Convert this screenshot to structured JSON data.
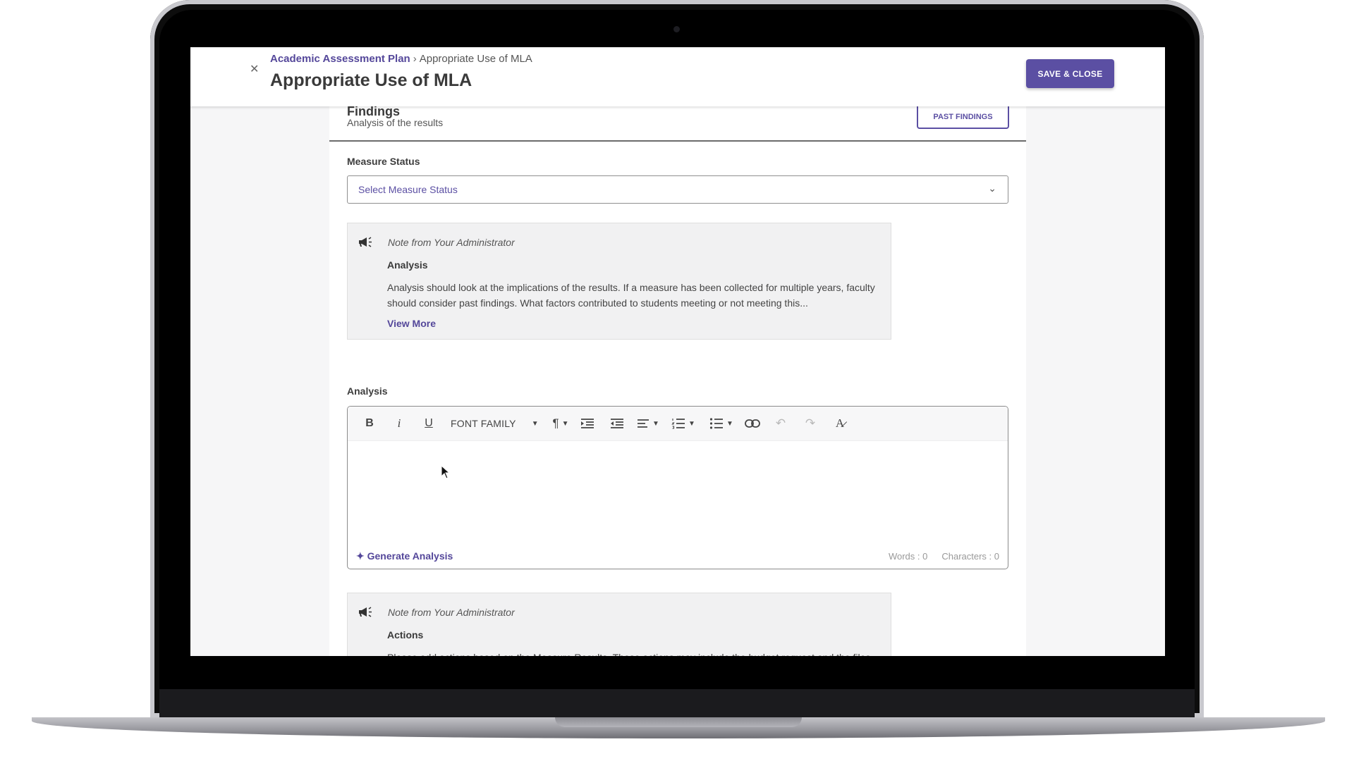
{
  "header": {
    "breadcrumb_parent": "Academic Assessment Plan",
    "breadcrumb_separator": "›",
    "breadcrumb_current": "Appropriate Use of MLA",
    "title": "Appropriate Use of MLA",
    "save_label": "SAVE & CLOSE",
    "close_icon": "close-icon"
  },
  "findings": {
    "title": "Findings",
    "subtitle": "Analysis of the results",
    "past_findings_label": "PAST FINDINGS"
  },
  "measure_status": {
    "label": "Measure Status",
    "placeholder": "Select Measure Status"
  },
  "note1": {
    "heading": "Note from Your Administrator",
    "title": "Analysis",
    "body": "Analysis should look at the implications of the results. If a measure has been collected for multiple years, faculty should consider past findings. What factors contributed to students meeting or not meeting this...",
    "view_more": "View More"
  },
  "analysis": {
    "label": "Analysis",
    "font_family_label": "FONT FAMILY",
    "generate_label": "Generate Analysis",
    "words": "Words : 0",
    "characters": "Characters : 0"
  },
  "note2": {
    "heading": "Note from Your Administrator",
    "title": "Actions",
    "body": "Please add actions based on the Measure Results. These actions may include the budget request and the files attached to the different actions"
  },
  "colors": {
    "accent": "#5b4fa3",
    "link": "#54479a"
  }
}
